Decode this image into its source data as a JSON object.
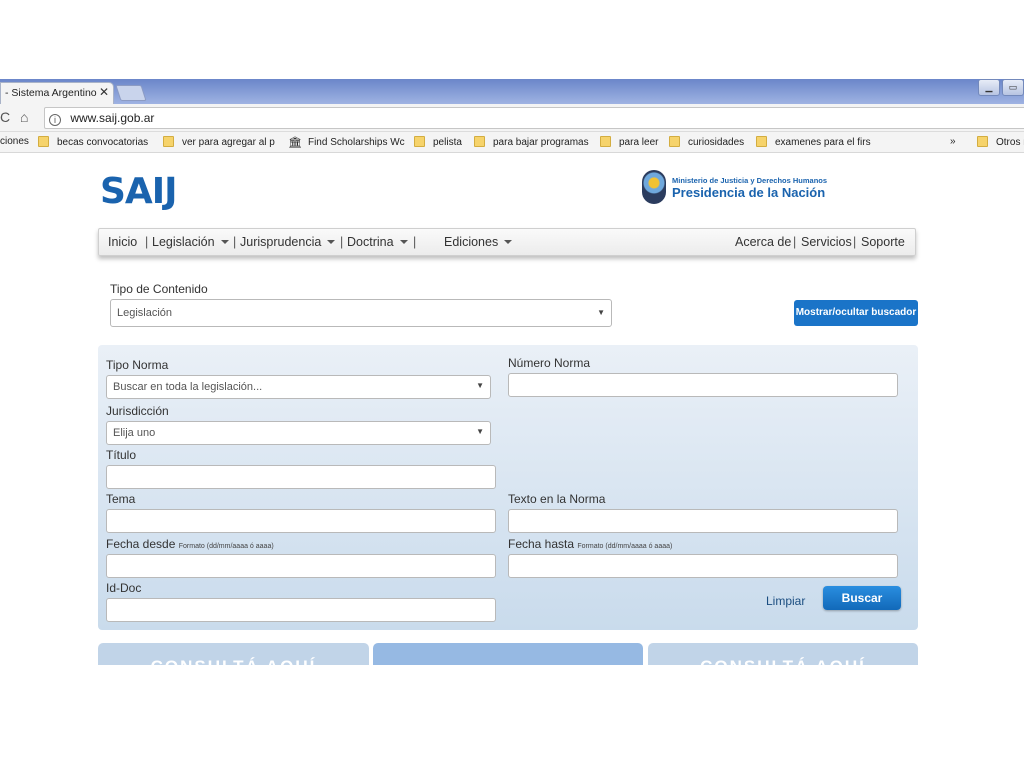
{
  "browser": {
    "tab_title": "- Sistema Argentino",
    "tab_close": "✕",
    "url": "www.saij.gob.ar",
    "bookmarks": [
      "ciones",
      "becas convocatorias",
      "ver para agregar al p",
      "Find Scholarships Wc",
      "pelista",
      "para bajar programas",
      "para leer",
      "curiosidades",
      "examenes para el firs"
    ],
    "more_bookmarks": "»",
    "other_bookmarks": "Otros m"
  },
  "header": {
    "logo": "SAIJ",
    "ministry": "Ministerio de Justicia y Derechos Humanos",
    "presidency": "Presidencia de la Nación"
  },
  "nav": {
    "items": [
      "Inicio",
      "Legislación",
      "Jurisprudencia",
      "Doctrina",
      "Ediciones"
    ],
    "right_items": [
      "Acerca de",
      "Servicios",
      "Soporte"
    ],
    "separator": "|"
  },
  "content_type": {
    "label": "Tipo de Contenido",
    "value": "Legislación"
  },
  "toggle_button": "Mostrar/ocultar buscador",
  "form": {
    "tipo_norma_label": "Tipo Norma",
    "tipo_norma_value": "Buscar en toda la legislación...",
    "numero_norma_label": "Número Norma",
    "jurisdiccion_label": "Jurisdicción",
    "jurisdiccion_value": "Elija uno",
    "titulo_label": "Título",
    "tema_label": "Tema",
    "texto_label": "Texto en la Norma",
    "fecha_desde_label": "Fecha desde",
    "fecha_hasta_label": "Fecha hasta",
    "fecha_format": "Formato (dd/mm/aaaa ó aaaa)",
    "iddoc_label": "Id-Doc",
    "clear_label": "Limpiar",
    "search_label": "Buscar"
  },
  "cards": [
    "CONSULTÁ AQUÍ",
    "",
    "CONSULTÁ AQUÍ"
  ],
  "colors": {
    "brand_blue": "#1a63ae",
    "button_blue": "#1a74c8",
    "panel_top": "#eaf0f7",
    "panel_bottom": "#c9dbec"
  }
}
